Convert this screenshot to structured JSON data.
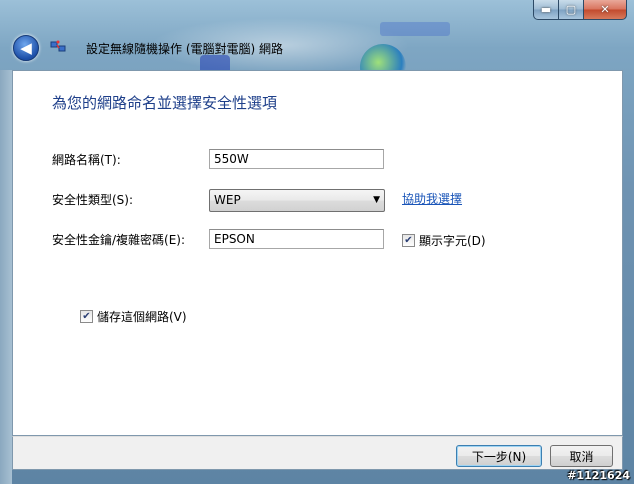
{
  "window": {
    "title": "設定無線隨機操作 (電腦對電腦) 網路",
    "controls": {
      "minimize": "▬",
      "maximize": "▢",
      "close": "✕"
    }
  },
  "nav": {
    "back_symbol": "◀",
    "back_icon": "back-arrow-icon",
    "app_icon": "network-adhoc-icon"
  },
  "page": {
    "heading": "為您的網路命名並選擇安全性選項",
    "network_name_label": "網路名稱(T):",
    "network_name_value": "550W",
    "security_type_label": "安全性類型(S):",
    "security_type_value": "WEP",
    "help_link": "協助我選擇",
    "security_key_label": "安全性金鑰/複雜密碼(E):",
    "security_key_value": "EPSON",
    "show_chars_label": "顯示字元(D)",
    "show_chars_checked": true,
    "save_network_label": "儲存這個網路(V)",
    "save_network_checked": true
  },
  "footer": {
    "next_label": "下一步(N)",
    "cancel_label": "取消"
  },
  "watermark": "#1121624",
  "colors": {
    "heading": "#1e3f8a",
    "link": "#1a55b8",
    "frame": "#6f93b2"
  }
}
